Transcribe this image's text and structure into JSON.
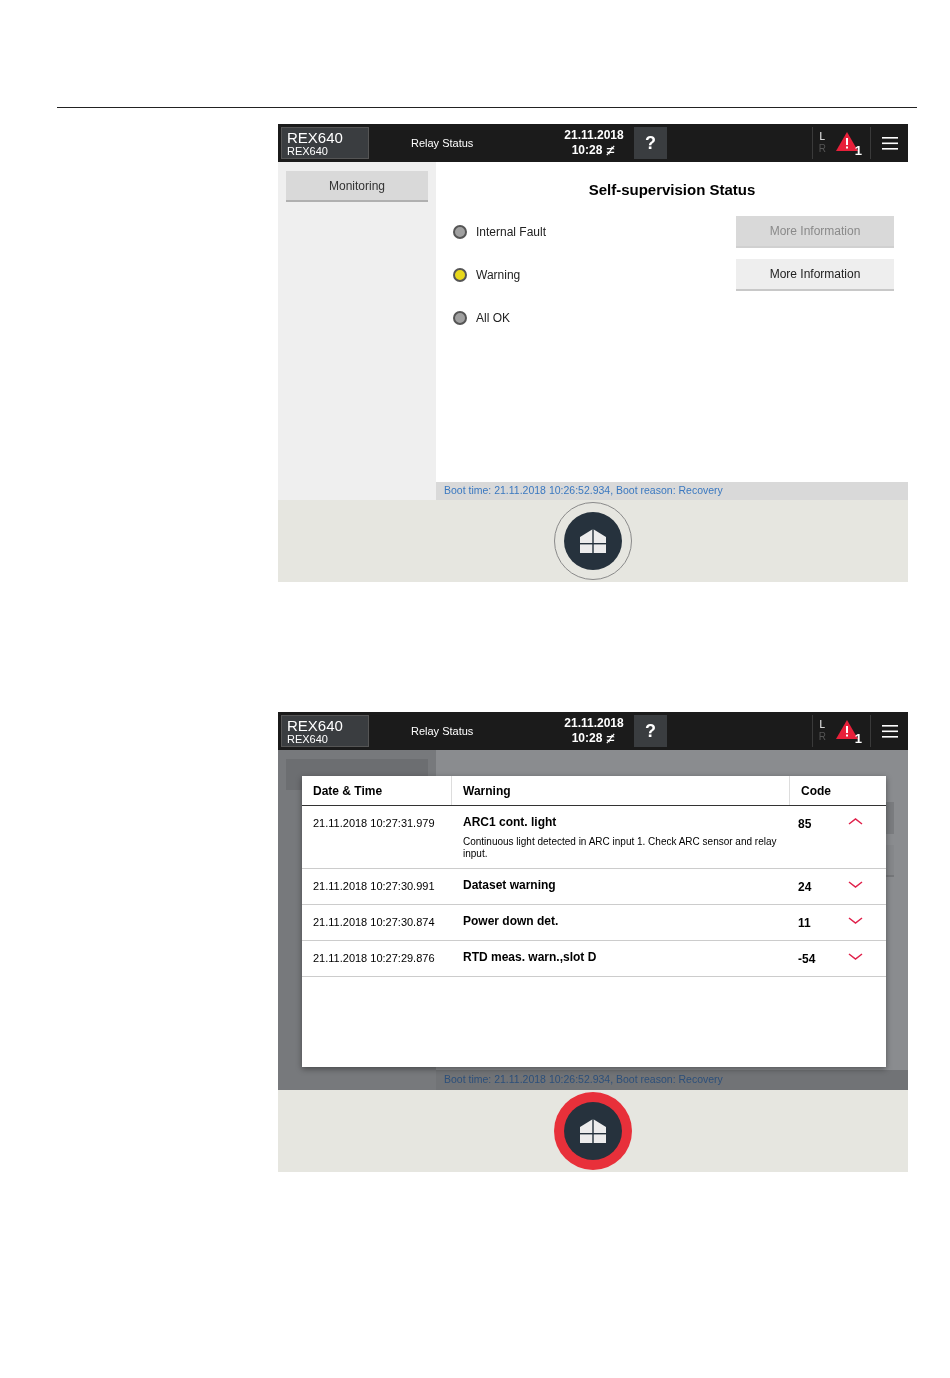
{
  "screens": [
    {
      "header": {
        "device_name": "REX640",
        "device_subtitle": "REX640",
        "page_title": "Relay Status",
        "date": "21.11.2018",
        "time": "10:28",
        "help": "?",
        "local": "L",
        "remote": "R",
        "alarm_count": "1"
      },
      "sidebar": {
        "items": [
          {
            "label": "Monitoring",
            "selected": true
          }
        ]
      },
      "title": "Self-supervision Status",
      "indicators": [
        {
          "label": "Internal Fault",
          "color": "#a0a0a0",
          "button": {
            "label": "More Information",
            "disabled": true
          }
        },
        {
          "label": "Warning",
          "color": "#e8d81c",
          "button": {
            "label": "More Information",
            "disabled": false
          }
        },
        {
          "label": "All OK",
          "color": "#a0a0a0"
        }
      ],
      "boot_info": "Boot time: 21.11.2018 10:26:52.934, Boot reason: Recovery",
      "home_alarm": false
    },
    {
      "header": {
        "device_name": "REX640",
        "device_subtitle": "REX640",
        "page_title": "Relay Status",
        "date": "21.11.2018",
        "time": "10:28",
        "help": "?",
        "local": "L",
        "remote": "R",
        "alarm_count": "1"
      },
      "boot_info": "Boot time: 21.11.2018 10:26:52.934, Boot reason: Recovery",
      "home_alarm": true,
      "dialog": {
        "columns": [
          "Date & Time",
          "Warning",
          "Code"
        ],
        "rows": [
          {
            "datetime": "21.11.2018 10:27:31.979",
            "warning": "ARC1 cont. light",
            "code": "85",
            "description": "Continuous light detected in ARC input 1. Check ARC sensor and relay input.",
            "expanded": true
          },
          {
            "datetime": "21.11.2018 10:27:30.991",
            "warning": "Dataset warning",
            "code": "24",
            "expanded": false
          },
          {
            "datetime": "21.11.2018 10:27:30.874",
            "warning": "Power down det.",
            "code": "11",
            "expanded": false
          },
          {
            "datetime": "21.11.2018 10:27:29.876",
            "warning": "RTD meas. warn.,slot D",
            "code": "-54",
            "expanded": false
          }
        ]
      }
    }
  ]
}
